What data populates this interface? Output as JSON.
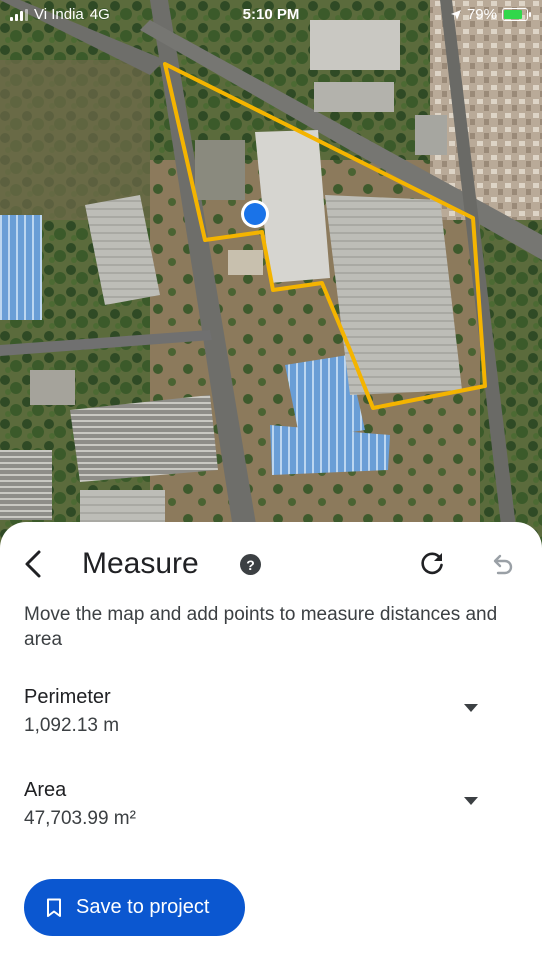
{
  "status_bar": {
    "carrier": "Vi India",
    "network": "4G",
    "time": "5:10 PM",
    "battery": "79%",
    "icons": [
      "signal-icon",
      "location-arrow-icon",
      "battery-icon"
    ]
  },
  "map": {
    "type": "satellite",
    "boundary_color": "#f4b400",
    "location_dot_color": "#1a73e8",
    "icons": [
      "location-dot-icon"
    ]
  },
  "sheet": {
    "title": "Measure",
    "help_icon": "?",
    "instructions": "Move the map and add points to measure distances and area",
    "perimeter": {
      "label": "Perimeter",
      "value": "1,092.13 m"
    },
    "area": {
      "label": "Area",
      "value": "47,703.99 m²"
    },
    "save_label": "Save to project",
    "icons": [
      "back-arrow-icon",
      "help-icon",
      "redo-icon",
      "undo-icon",
      "chevron-down-icon",
      "bookmark-icon"
    ]
  },
  "colors": {
    "accent": "#0b57d0",
    "text_primary": "#202124",
    "text_secondary": "#3c4043",
    "undo_disabled": "#9aa0a6"
  }
}
